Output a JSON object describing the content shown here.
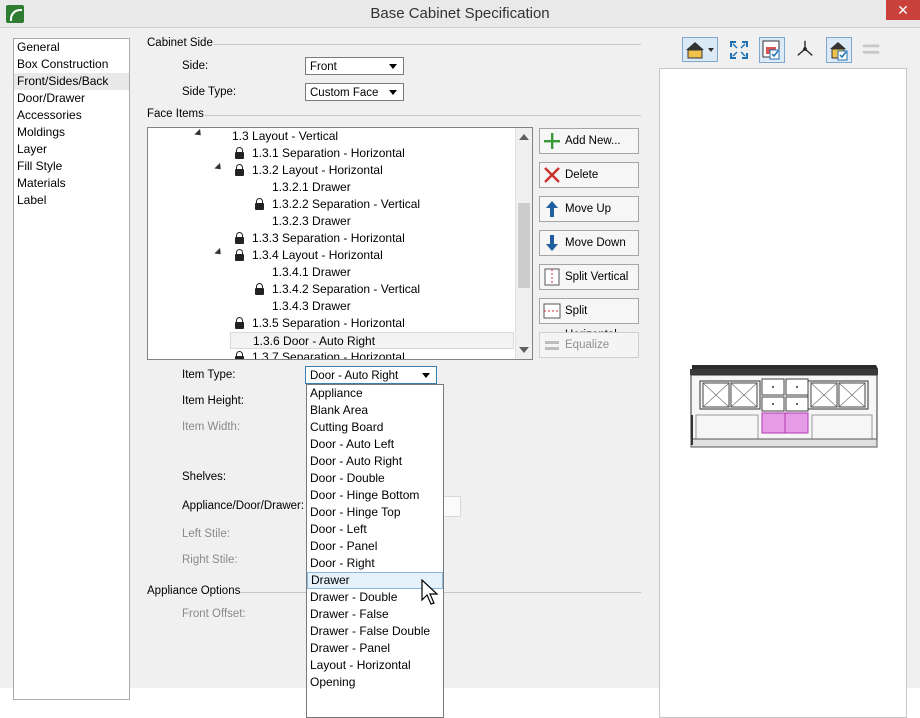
{
  "window": {
    "title": "Base Cabinet Specification"
  },
  "nav": {
    "items": [
      "General",
      "Box Construction",
      "Front/Sides/Back",
      "Door/Drawer",
      "Accessories",
      "Moldings",
      "Layer",
      "Fill Style",
      "Materials",
      "Label"
    ],
    "selected": "Front/Sides/Back"
  },
  "cabinet_side": {
    "section_label": "Cabinet Side",
    "side_label": "Side:",
    "side_value": "Front",
    "side_type_label": "Side Type:",
    "side_type_value": "Custom Face"
  },
  "face_items": {
    "section_label": "Face Items",
    "tree": [
      {
        "label": "1.3 Layout - Vertical",
        "expanded": true,
        "locked": false
      },
      {
        "label": "1.3.1 Separation - Horizontal",
        "locked": true
      },
      {
        "label": "1.3.2 Layout - Horizontal",
        "expanded": true,
        "locked": true
      },
      {
        "label": "1.3.2.1 Drawer",
        "locked": false
      },
      {
        "label": "1.3.2.2 Separation - Vertical",
        "locked": true
      },
      {
        "label": "1.3.2.3 Drawer",
        "locked": false
      },
      {
        "label": "1.3.3 Separation - Horizontal",
        "locked": true
      },
      {
        "label": "1.3.4 Layout - Horizontal",
        "expanded": true,
        "locked": true
      },
      {
        "label": "1.3.4.1 Drawer",
        "locked": false
      },
      {
        "label": "1.3.4.2 Separation - Vertical",
        "locked": true
      },
      {
        "label": "1.3.4.3 Drawer",
        "locked": false
      },
      {
        "label": "1.3.5 Separation - Horizontal",
        "locked": true
      },
      {
        "label": "1.3.6 Door - Auto Right",
        "locked": false,
        "selected": true
      },
      {
        "label": "1.3.7 Separation - Horizontal",
        "locked": true
      }
    ]
  },
  "buttons": {
    "add_new": "Add New...",
    "delete": "Delete",
    "move_up": "Move Up",
    "move_down": "Move Down",
    "split_vertical": "Split Vertical",
    "split_horizontal": "Split Horizontal",
    "equalize": "Equalize"
  },
  "item": {
    "item_type_label": "Item Type:",
    "item_type_value": "Door - Auto Right",
    "item_height_label": "Item Height:",
    "item_width_label": "Item Width:",
    "shelves_label": "Shelves:",
    "appliance_door_drawer_label": "Appliance/Door/Drawer:",
    "left_stile_label": "Left Stile:",
    "right_stile_label": "Right Stile:"
  },
  "appliance_options": {
    "section_label": "Appliance Options",
    "front_offset_label": "Front Offset:"
  },
  "item_type_dropdown": {
    "options": [
      "Appliance",
      "Blank Area",
      "Cutting Board",
      "Door - Auto Left",
      "Door - Auto Right",
      "Door - Double",
      "Door - Hinge Bottom",
      "Door - Hinge Top",
      "Door - Left",
      "Door - Panel",
      "Door - Right",
      "Drawer",
      "Drawer - Double",
      "Drawer - False",
      "Drawer - False Double",
      "Drawer - Panel",
      "Layout - Horizontal",
      "Opening"
    ],
    "highlighted": "Drawer"
  },
  "preview_toolbar": {
    "icons": [
      "camera-view-icon",
      "dropdown-arrow-icon",
      "fill-window-icon",
      "plan-view-icon",
      "axes-icon",
      "elevation-view-icon",
      "reset-icon"
    ]
  },
  "colors": {
    "accent": "#0b5ea8",
    "highlight_pink": "#e59be6",
    "countertop": "#2a2a2a"
  }
}
